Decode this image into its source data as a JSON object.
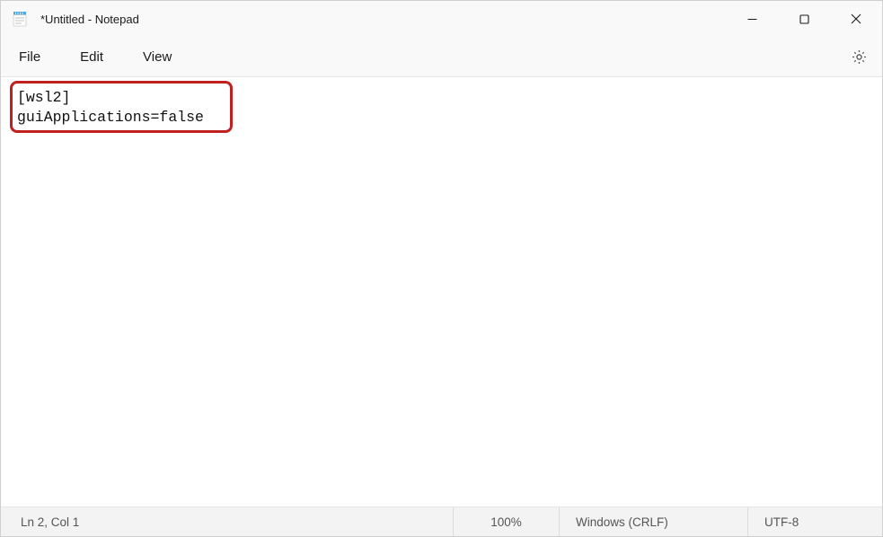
{
  "window": {
    "title": "*Untitled - Notepad"
  },
  "menu": {
    "file": "File",
    "edit": "Edit",
    "view": "View"
  },
  "editor": {
    "content": "[wsl2]\nguiApplications=false"
  },
  "status": {
    "position": "Ln 2, Col 1",
    "zoom": "100%",
    "line_ending": "Windows (CRLF)",
    "encoding": "UTF-8"
  },
  "icons": {
    "app": "notepad-icon",
    "settings": "gear-icon",
    "minimize": "minimize-icon",
    "maximize": "maximize-icon",
    "close": "close-icon"
  }
}
